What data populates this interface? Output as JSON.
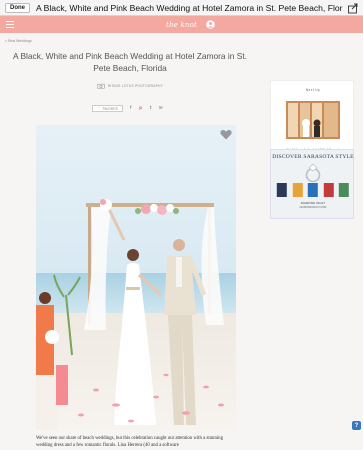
{
  "appbar": {
    "done_label": "Done",
    "title": "A Black, White and Pink Beach Wedding at Hotel Zamora in St. Pete Beach, Florida"
  },
  "site": {
    "logo_text": "the knot"
  },
  "breadcrumb": "< Real Weddings",
  "article": {
    "title": "A Black, White and Pink Beach Wedding at Hotel Zamora in St. Pete Beach, Florida",
    "photographer": "RISING LOTUS PHOTOGRAPHY",
    "favorite_label": "FAVORITE",
    "share_icons": [
      "f",
      "p",
      "t",
      "✉"
    ],
    "caption": "We've seen our share of beach weddings, but this celebration caught our attention with a stunning wedding dress and a few romantic florals. Lina Herrera (40 and a software"
  },
  "sidebar": {
    "next_label": "Next Up",
    "next_title": "An Urban Industrial Wedding at Neighborhood Theatre in Charlotte, ..."
  },
  "ad": {
    "headline": "DISCOVER SARASOTA STYLE",
    "brand": "DIAMOND VAULT",
    "subtext": "DIAMONDVAULT.COM"
  },
  "colors": {
    "brand_pink": "#f3a9a0",
    "help_blue": "#3a76b8"
  },
  "icons": {
    "share": "share-icon",
    "menu": "menu-icon",
    "profile": "profile-icon",
    "favorite": "heart-icon",
    "help": "help-icon"
  },
  "help_label": "?"
}
